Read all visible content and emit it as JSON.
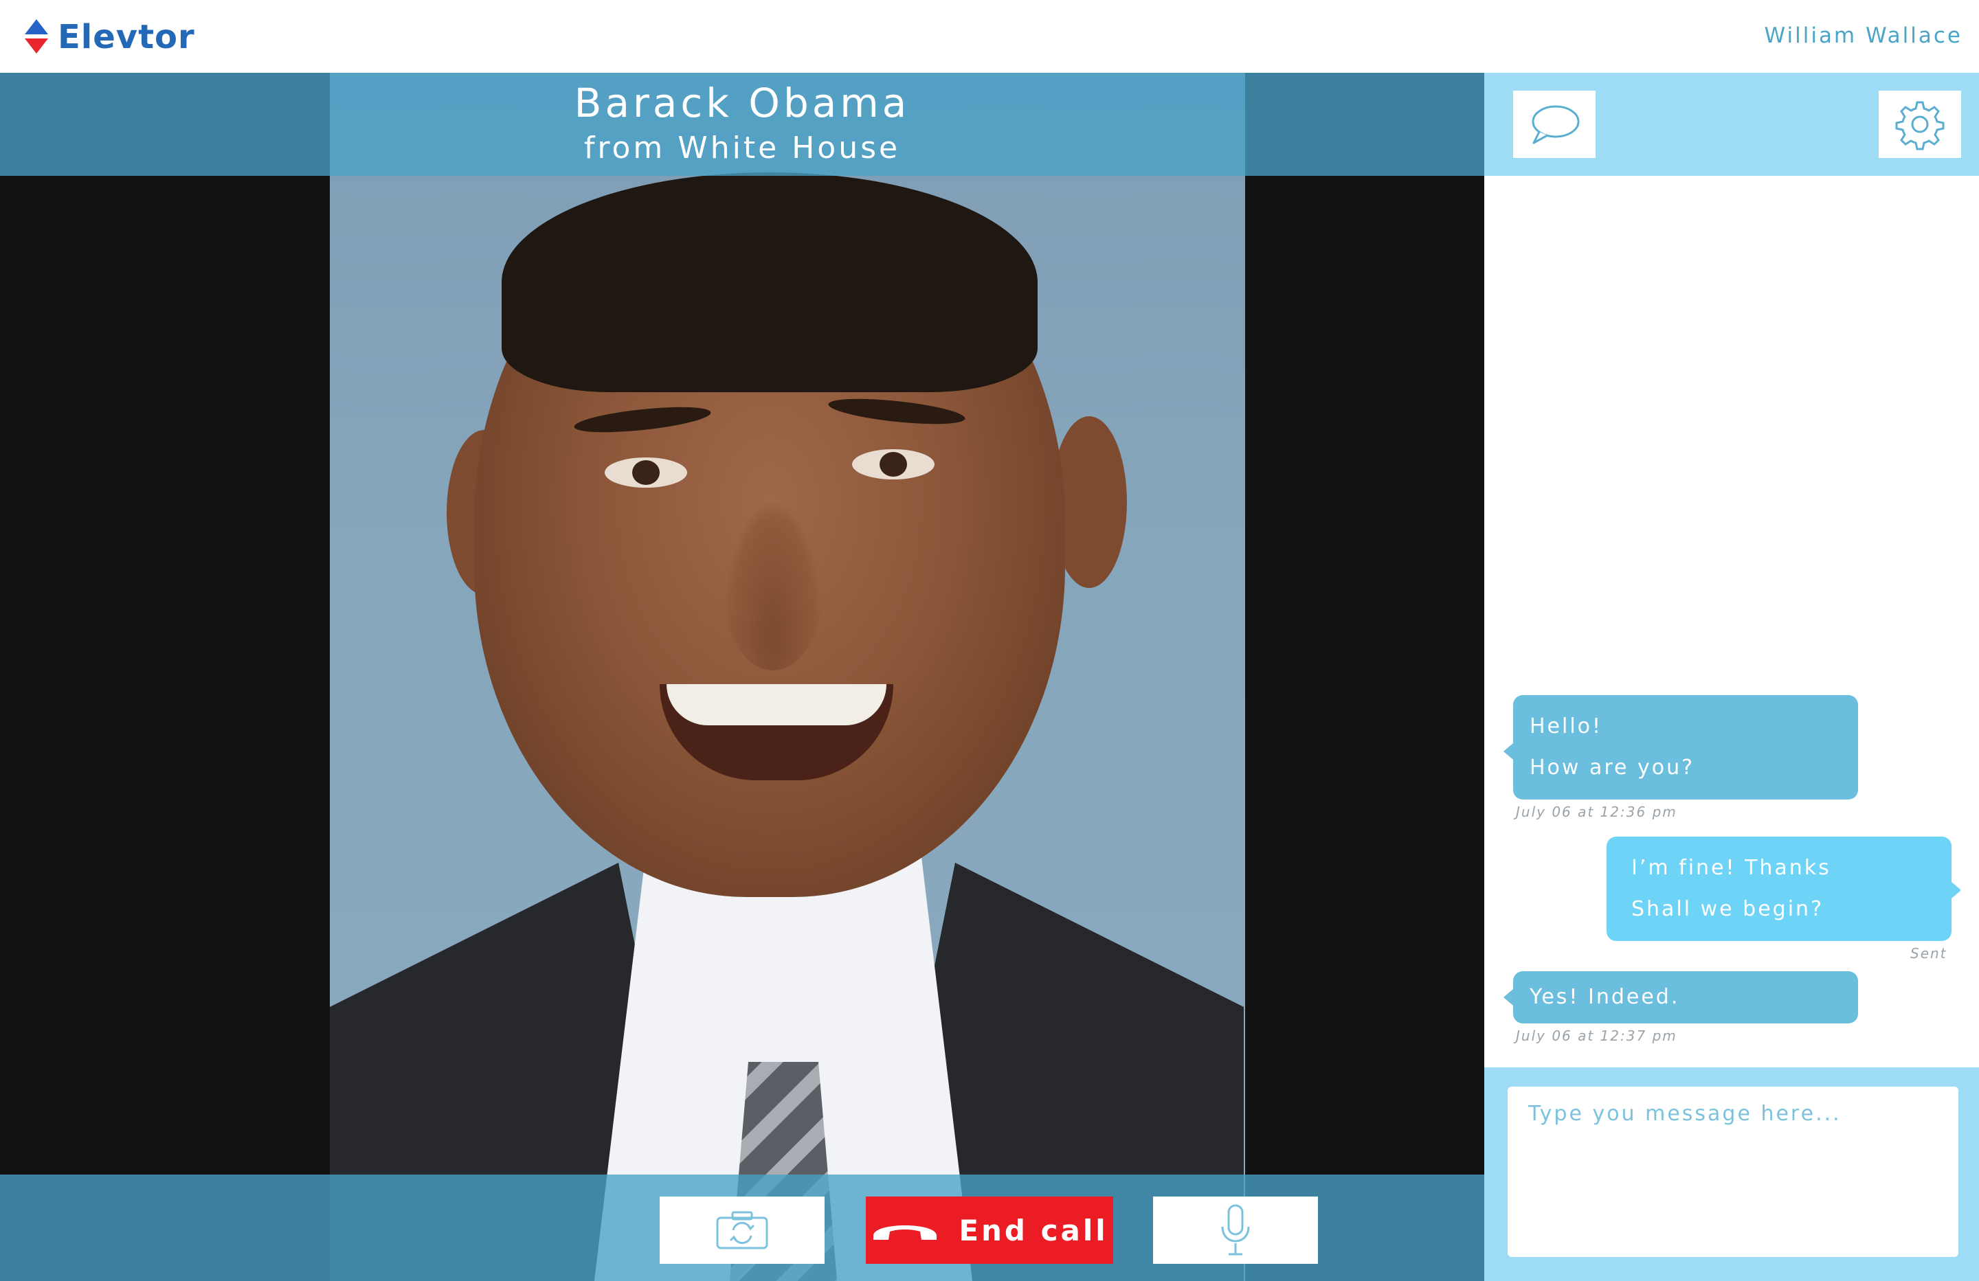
{
  "app": {
    "name": "Elevtor",
    "user": "William Wallace"
  },
  "call": {
    "caller_name": "Barack Obama",
    "caller_org": "from White House",
    "controls": {
      "switch_camera": "switch-camera",
      "end_call": "End call",
      "microphone": "microphone"
    }
  },
  "chat": {
    "messages": [
      {
        "direction": "incoming",
        "lines": [
          "Hello!",
          "How are you?"
        ],
        "meta": "July 06 at 12:36 pm"
      },
      {
        "direction": "outgoing",
        "lines": [
          "I’m fine! Thanks",
          "Shall we begin?"
        ],
        "meta": "Sent"
      },
      {
        "direction": "incoming",
        "lines": [
          "Yes! Indeed."
        ],
        "meta": "July 06 at 12:37 pm"
      }
    ],
    "input": {
      "value": "",
      "placeholder": "Type you message here..."
    }
  },
  "colors": {
    "brand_blue": "#2468b8",
    "brand_red": "#e8262b",
    "end_call_red": "#ec1c24",
    "overlay_blue": "#48a2c8",
    "sidebar_blue": "#9ddcf4",
    "bubble_incoming": "#6cbede",
    "bubble_outgoing": "#6dd3f7"
  }
}
